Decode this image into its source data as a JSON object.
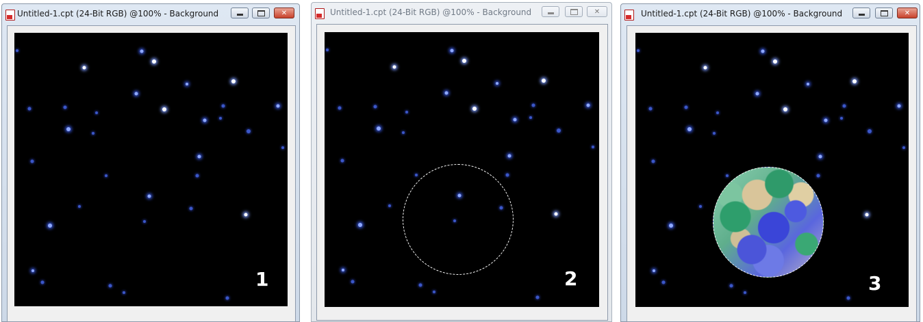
{
  "windows": [
    {
      "title": "Untitled-1.cpt (24-Bit RGB) @100% - Background",
      "state": "active",
      "label": "1",
      "selection": "none"
    },
    {
      "title": "Untitled-1.cpt (24-Bit RGB) @100% - Background",
      "state": "inactive",
      "label": "2",
      "selection": "circle-marquee"
    },
    {
      "title": "Untitled-1.cpt (24-Bit RGB) @100% - Background",
      "state": "active",
      "label": "3",
      "selection": "circle-marquee-filled-planet"
    }
  ],
  "title_buttons": {
    "minimize_icon": "minimize-icon",
    "maximize_icon": "maximize-icon",
    "close_icon": "close-icon",
    "close_glyph": "✕"
  },
  "colors": {
    "canvas_background": "#000000",
    "star_color": "#6f8dff",
    "planet_water": "#4450d8",
    "planet_land": "#d9c59a",
    "planet_forest": "#2f9a6a"
  }
}
